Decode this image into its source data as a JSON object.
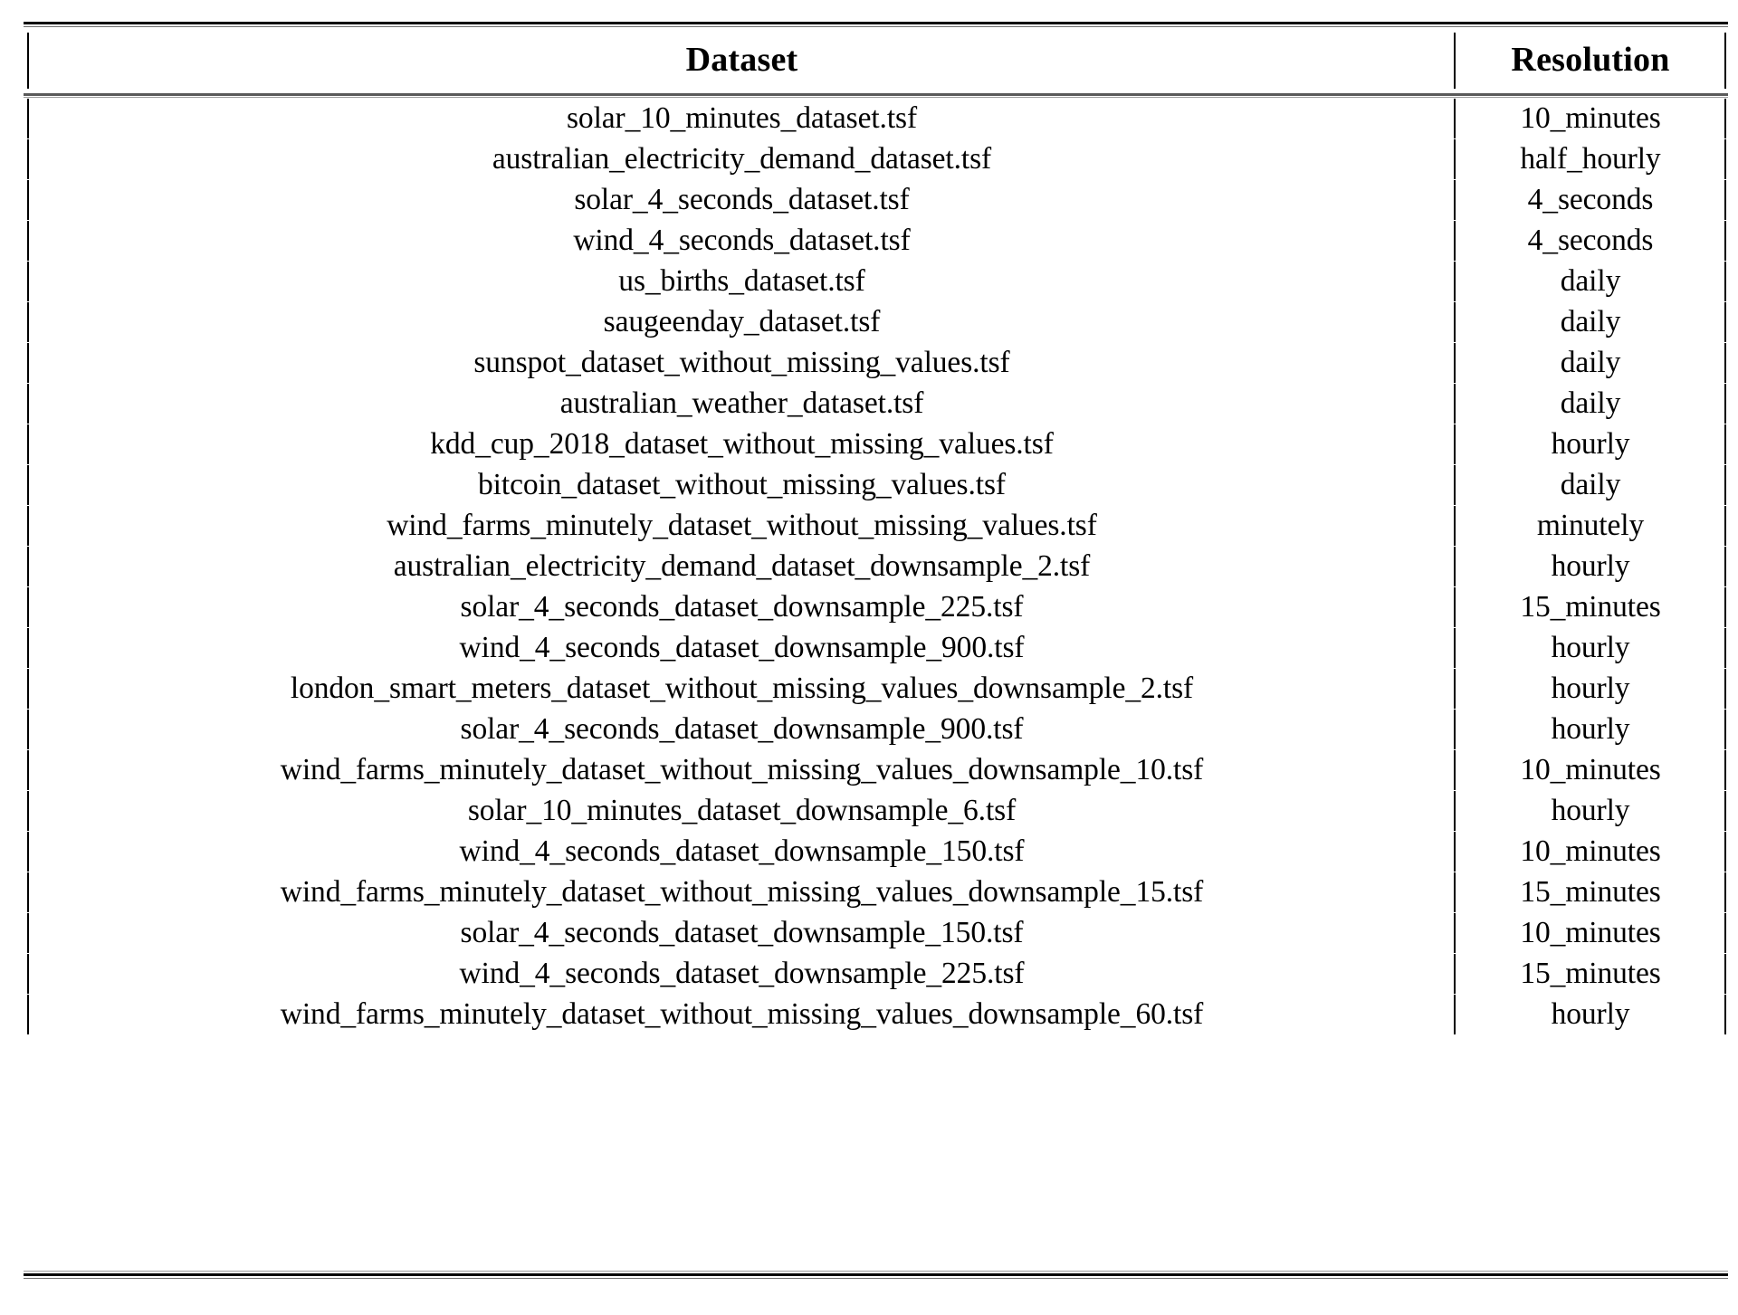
{
  "table": {
    "columns": [
      {
        "key": "dataset",
        "label": "Dataset",
        "align": "center"
      },
      {
        "key": "resolution",
        "label": "Resolution",
        "align": "center"
      }
    ],
    "rows": [
      {
        "dataset": "solar_10_minutes_dataset.tsf",
        "resolution": "10_minutes"
      },
      {
        "dataset": "australian_electricity_demand_dataset.tsf",
        "resolution": "half_hourly"
      },
      {
        "dataset": "solar_4_seconds_dataset.tsf",
        "resolution": "4_seconds"
      },
      {
        "dataset": "wind_4_seconds_dataset.tsf",
        "resolution": "4_seconds"
      },
      {
        "dataset": "us_births_dataset.tsf",
        "resolution": "daily"
      },
      {
        "dataset": "saugeenday_dataset.tsf",
        "resolution": "daily"
      },
      {
        "dataset": "sunspot_dataset_without_missing_values.tsf",
        "resolution": "daily"
      },
      {
        "dataset": "australian_weather_dataset.tsf",
        "resolution": "daily"
      },
      {
        "dataset": "kdd_cup_2018_dataset_without_missing_values.tsf",
        "resolution": "hourly"
      },
      {
        "dataset": "bitcoin_dataset_without_missing_values.tsf",
        "resolution": "daily"
      },
      {
        "dataset": "wind_farms_minutely_dataset_without_missing_values.tsf",
        "resolution": "minutely"
      },
      {
        "dataset": "australian_electricity_demand_dataset_downsample_2.tsf",
        "resolution": "hourly"
      },
      {
        "dataset": "solar_4_seconds_dataset_downsample_225.tsf",
        "resolution": "15_minutes"
      },
      {
        "dataset": "wind_4_seconds_dataset_downsample_900.tsf",
        "resolution": "hourly"
      },
      {
        "dataset": "london_smart_meters_dataset_without_missing_values_downsample_2.tsf",
        "resolution": "hourly"
      },
      {
        "dataset": "solar_4_seconds_dataset_downsample_900.tsf",
        "resolution": "hourly"
      },
      {
        "dataset": "wind_farms_minutely_dataset_without_missing_values_downsample_10.tsf",
        "resolution": "10_minutes"
      },
      {
        "dataset": "solar_10_minutes_dataset_downsample_6.tsf",
        "resolution": "hourly"
      },
      {
        "dataset": "wind_4_seconds_dataset_downsample_150.tsf",
        "resolution": "10_minutes"
      },
      {
        "dataset": "wind_farms_minutely_dataset_without_missing_values_downsample_15.tsf",
        "resolution": "15_minutes"
      },
      {
        "dataset": "solar_4_seconds_dataset_downsample_150.tsf",
        "resolution": "10_minutes"
      },
      {
        "dataset": "wind_4_seconds_dataset_downsample_225.tsf",
        "resolution": "15_minutes"
      },
      {
        "dataset": "wind_farms_minutely_dataset_without_missing_values_downsample_60.tsf",
        "resolution": "hourly"
      }
    ]
  }
}
